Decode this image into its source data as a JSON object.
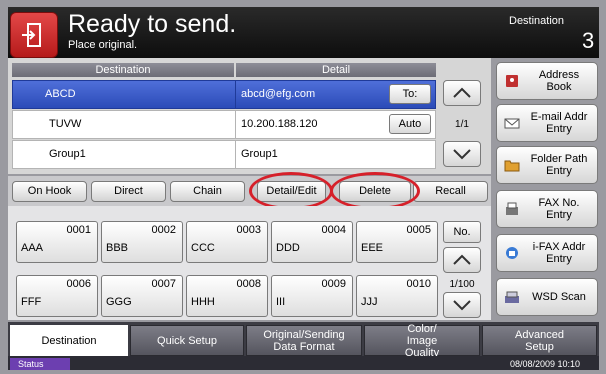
{
  "header": {
    "title": "Ready to send.",
    "subtitle": "Place original.",
    "destination_label": "Destination",
    "destination_count": "3"
  },
  "table": {
    "col_destination": "Destination",
    "col_detail": "Detail",
    "rows": [
      {
        "name": "ABCD",
        "detail": "abcd@efg.com",
        "button": "To:",
        "selected": true
      },
      {
        "name": "TUVW",
        "detail": "10.200.188.120",
        "button": "Auto",
        "selected": false
      },
      {
        "name": "Group1",
        "detail": "Group1",
        "button": "",
        "selected": false
      }
    ],
    "page": "1/1"
  },
  "side_buttons": {
    "address_book": "Address Book",
    "email_entry": "E-mail Addr Entry",
    "folder_path": "Folder Path Entry",
    "fax_no": "FAX No. Entry",
    "ifax": "i-FAX Addr Entry",
    "wsd_scan": "WSD Scan"
  },
  "actions": {
    "on_hook": "On Hook",
    "direct": "Direct",
    "chain": "Chain",
    "detail_edit": "Detail/Edit",
    "delete": "Delete",
    "recall": "Recall"
  },
  "keys": [
    {
      "num": "0001",
      "name": "AAA"
    },
    {
      "num": "0002",
      "name": "BBB"
    },
    {
      "num": "0003",
      "name": "CCC"
    },
    {
      "num": "0004",
      "name": "DDD"
    },
    {
      "num": "0005",
      "name": "EEE"
    },
    {
      "num": "0006",
      "name": "FFF"
    },
    {
      "num": "0007",
      "name": "GGG"
    },
    {
      "num": "0008",
      "name": "HHH"
    },
    {
      "num": "0009",
      "name": "III"
    },
    {
      "num": "0010",
      "name": "JJJ"
    }
  ],
  "keys_nav": {
    "no_label": "No.",
    "page": "1/100"
  },
  "tabs": {
    "destination": "Destination",
    "quick_setup": "Quick Setup",
    "original_sending": "Original/Sending Data Format",
    "color_image": "Color/ Image Quality",
    "advanced_setup": "Advanced Setup"
  },
  "status": {
    "label": "Status",
    "datetime": "08/08/2009   10:10"
  },
  "colors": {
    "accent_red": "#d6202a",
    "selected_row": "#2b4bb8",
    "status_purple": "#6c3fb0"
  }
}
